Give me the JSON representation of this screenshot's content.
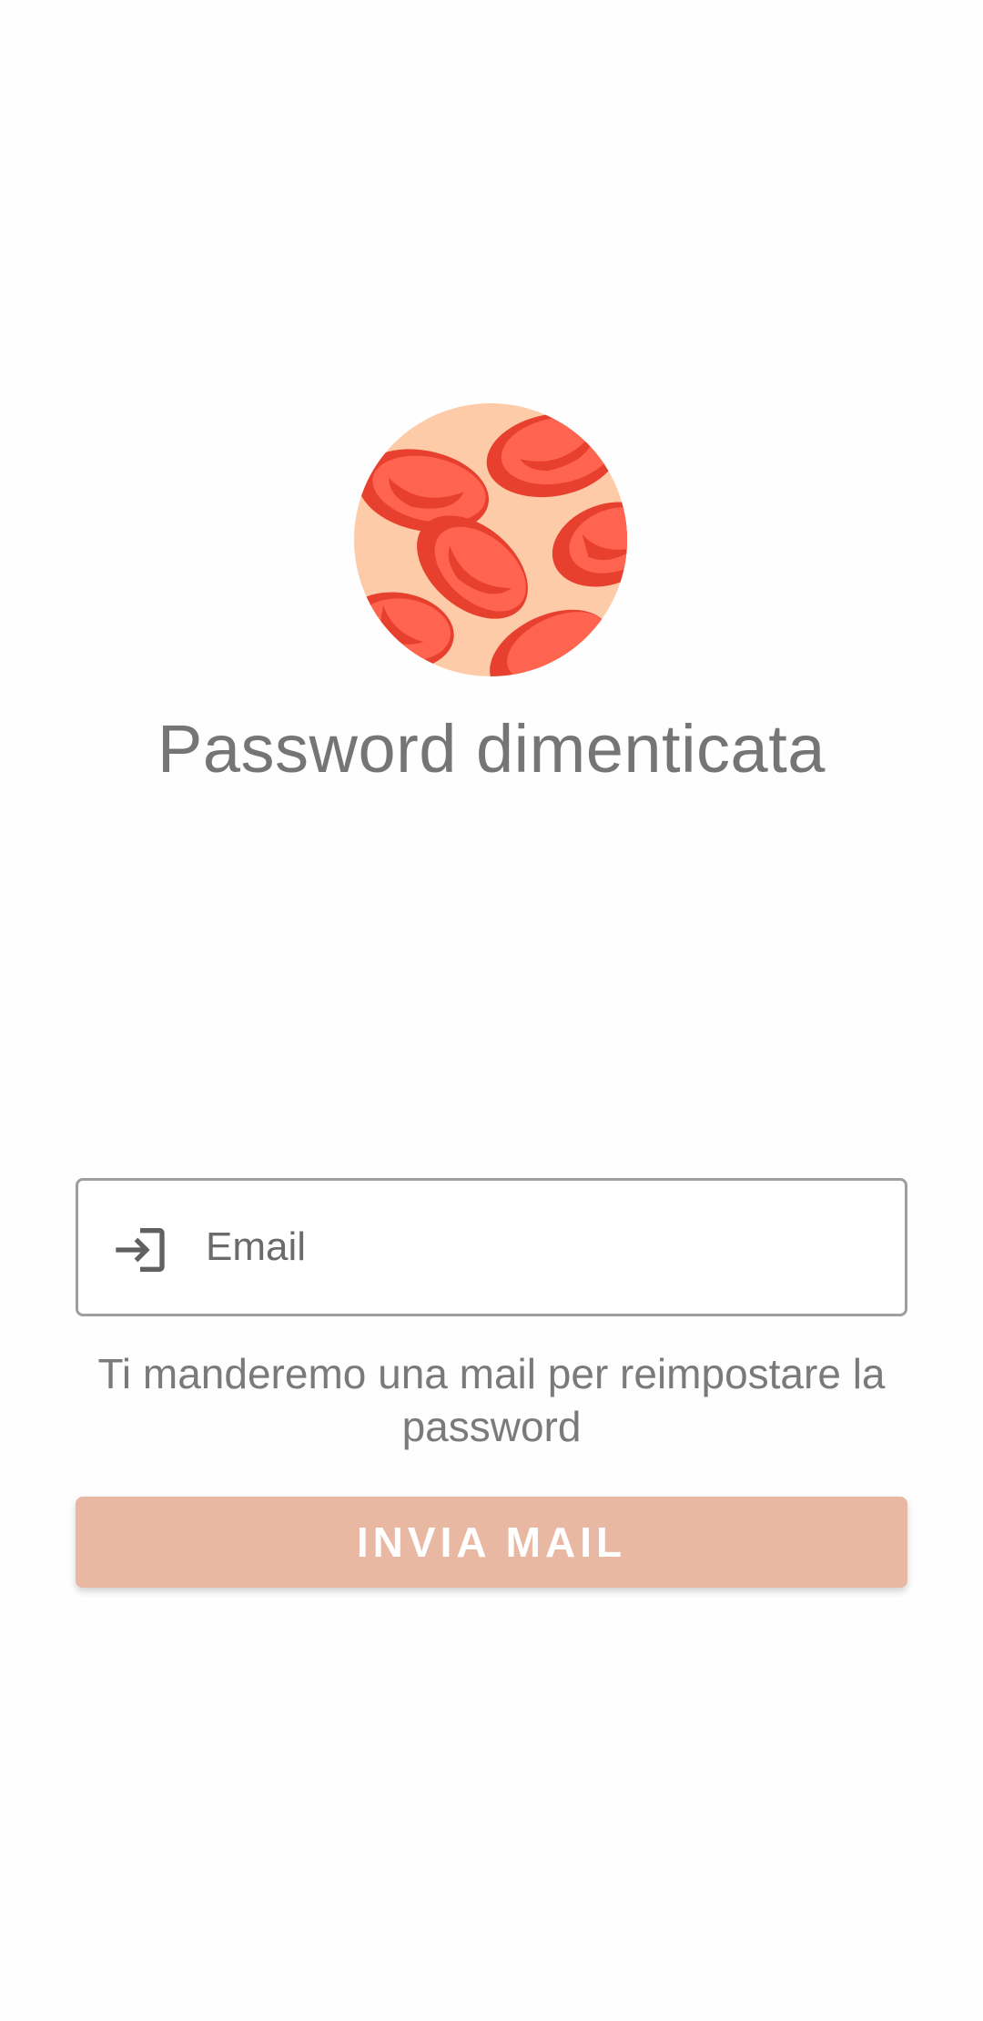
{
  "screen": {
    "title": "Password dimenticata",
    "logo_icon": "red-blood-cells-icon"
  },
  "form": {
    "email_icon": "login-arrow-icon",
    "email_placeholder": "Email",
    "email_value": "",
    "helper_text": "Ti manderemo una mail per reimpostare la password",
    "submit_label": "INVIA MAIL"
  },
  "colors": {
    "background": "#fefefe",
    "logo_circle": "#fecba9",
    "cell_light": "#ff6450",
    "cell_dark": "#e8402e",
    "title_text": "#757575",
    "button_bg": "#e9b8a3",
    "button_text": "#ffffff",
    "field_border": "#9e9e9e"
  }
}
